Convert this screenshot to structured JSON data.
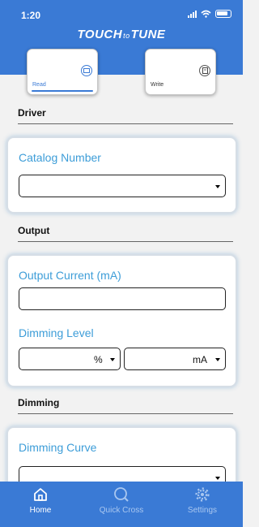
{
  "status_bar": {
    "time": "1:20"
  },
  "app": {
    "logo_part1": "TOUCH",
    "logo_part2": "to",
    "logo_part3": "TUNE"
  },
  "modes": [
    {
      "label": "Read",
      "icon": "read-card-icon",
      "active": true
    },
    {
      "label": "Write",
      "icon": "write-card-icon",
      "active": false
    }
  ],
  "sections": {
    "driver": {
      "title": "Driver",
      "catalog_number": {
        "label": "Catalog Number",
        "value": ""
      }
    },
    "output": {
      "title": "Output",
      "output_current": {
        "label": "Output Current (mA)",
        "value": ""
      },
      "dimming_level": {
        "label": "Dimming Level",
        "unit_percent": "%",
        "unit_ma": "mA"
      }
    },
    "dimming": {
      "title": "Dimming",
      "dimming_curve": {
        "label": "Dimming Curve",
        "value": ""
      }
    }
  },
  "tab_bar": [
    {
      "label": "Home",
      "icon": "home-icon",
      "active": true
    },
    {
      "label": "Quick Cross",
      "icon": "search-icon",
      "active": false
    },
    {
      "label": "Settings",
      "icon": "gear-icon",
      "active": false
    }
  ],
  "colors": {
    "brand_blue": "#3a7ad5",
    "label_blue": "#3d9dd8"
  }
}
